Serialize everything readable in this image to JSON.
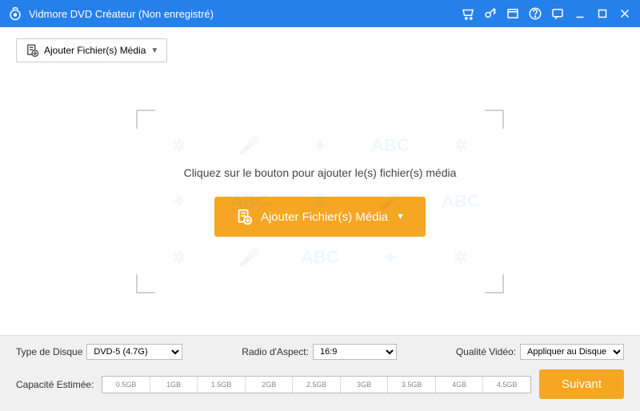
{
  "titlebar": {
    "title": "Vidmore DVD Créateur (Non enregistré)"
  },
  "toolbar": {
    "add_media_label": "Ajouter Fichier(s) Média"
  },
  "dropzone": {
    "hint": "Cliquez sur le bouton pour ajouter le(s) fichier(s) média",
    "button_label": "Ajouter Fichier(s) Média"
  },
  "bottom": {
    "disc_type_label": "Type de Disque",
    "disc_type_value": "DVD-5 (4.7G)",
    "aspect_label": "Radio d'Aspect:",
    "aspect_value": "16:9",
    "quality_label": "Qualité Vidéo:",
    "quality_value": "Appliquer au Disque",
    "capacity_label": "Capacité Estimée:",
    "ticks": [
      "0.5GB",
      "1GB",
      "1.5GB",
      "2GB",
      "2.5GB",
      "3GB",
      "3.5GB",
      "4GB",
      "4.5GB"
    ],
    "next_label": "Suivant"
  }
}
